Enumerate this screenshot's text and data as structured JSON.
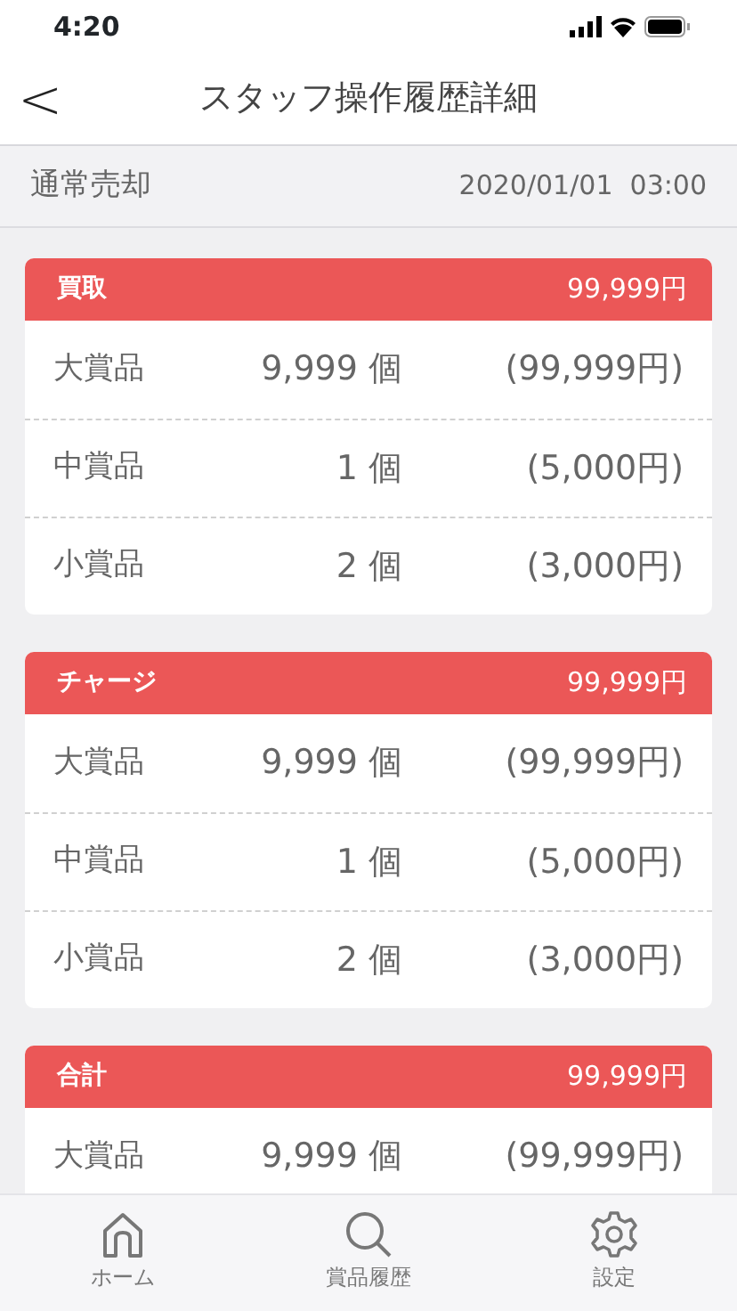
{
  "status_bar": {
    "time": "4:20"
  },
  "header": {
    "back": "<",
    "title": "スタッフ操作履歴詳細"
  },
  "summary": {
    "type": "通常売却",
    "datetime": "2020/01/01  03:00"
  },
  "sections": [
    {
      "title": "買取",
      "total": "99,999円",
      "rows": [
        {
          "name": "大賞品",
          "quantity": "9,999 個",
          "amount": "(99,999円)"
        },
        {
          "name": "中賞品",
          "quantity": "1 個",
          "amount": "(5,000円)"
        },
        {
          "name": "小賞品",
          "quantity": "2 個",
          "amount": "(3,000円)"
        }
      ]
    },
    {
      "title": "チャージ",
      "total": "99,999円",
      "rows": [
        {
          "name": "大賞品",
          "quantity": "9,999 個",
          "amount": "(99,999円)"
        },
        {
          "name": "中賞品",
          "quantity": "1 個",
          "amount": "(5,000円)"
        },
        {
          "name": "小賞品",
          "quantity": "2 個",
          "amount": "(3,000円)"
        }
      ]
    },
    {
      "title": "合計",
      "total": "99,999円",
      "rows": [
        {
          "name": "大賞品",
          "quantity": "9,999 個",
          "amount": "(99,999円)"
        }
      ]
    }
  ],
  "tab_bar": [
    {
      "kind": "home",
      "label": "ホーム"
    },
    {
      "kind": "search",
      "label": "賞品履歴"
    },
    {
      "kind": "settings",
      "label": "設定"
    }
  ]
}
